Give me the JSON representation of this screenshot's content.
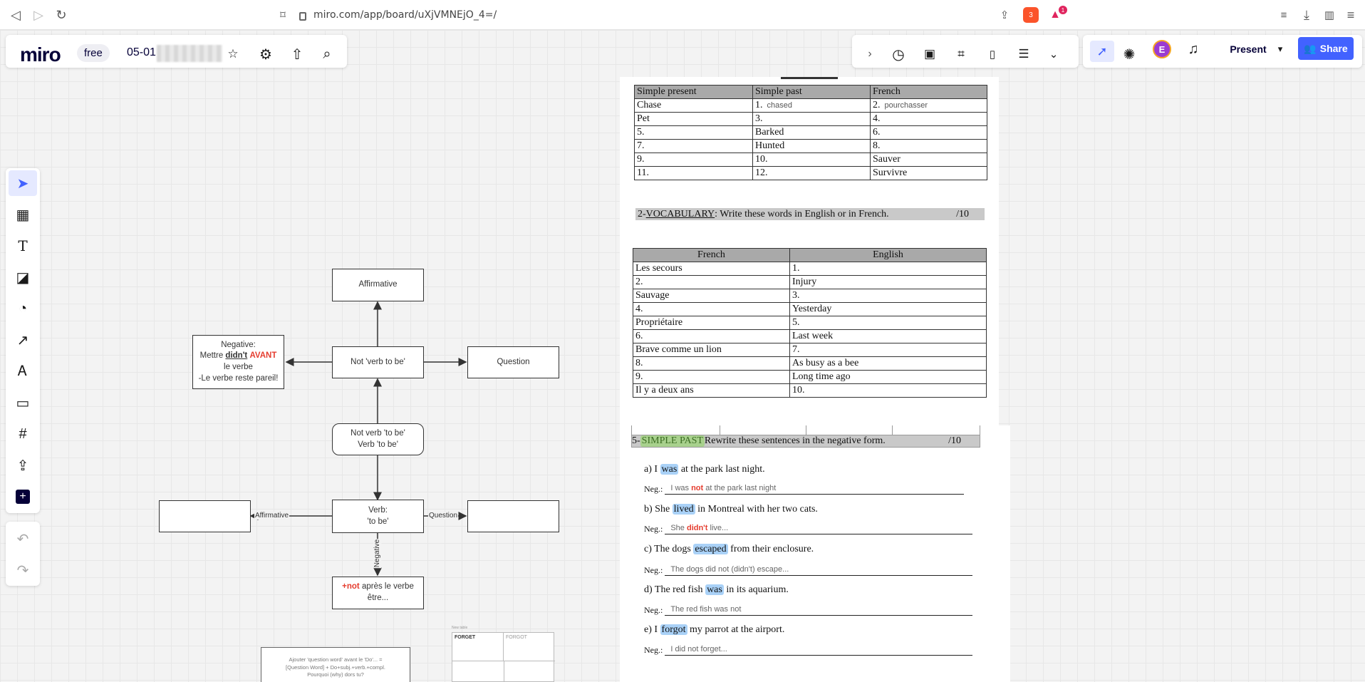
{
  "browser": {
    "url": "miro.com/app/board/uXjVMNEjO_4=/",
    "ext_badge_1": "3",
    "ext_badge_2": "1"
  },
  "header": {
    "logo": "miro",
    "plan_badge": "free",
    "board_name": "05-01"
  },
  "right_header": {
    "avatar_initial": "E",
    "present_label": "Present",
    "share_label": "Share"
  },
  "diagram": {
    "affirmative_top": "Affirmative",
    "not_verb_to_be": "Not 'verb to be'",
    "question_mid": "Question",
    "negative_line1": "Negative:",
    "negative_line2a": "Mettre ",
    "negative_line2b": "didn't",
    "negative_line2c": "AVANT",
    "negative_line3": "le verbe",
    "negative_line4": "-Le verbe reste pareil!",
    "choice_line1": "Not verb 'to be'",
    "choice_line2": "Verb 'to be'",
    "verb_line1": "Verb:",
    "verb_line2": "'to be'",
    "label_affirmative": "Affirmative",
    "label_question": "Question",
    "label_negative": "Negative",
    "not_box_a": "+not",
    "not_box_b": " après le verbe",
    "not_box_c": "être...",
    "small_note": "Ajouter 'question word' avant le 'Do'... = [Question Word] + Do+subj.+verb.+compl. Pourquoi (why) dors tu?",
    "mini_table_head1": "FORGET",
    "mini_table_head2": "FORGOT",
    "mini_caption": "New table"
  },
  "doc": {
    "table1": {
      "headers": [
        "Simple present",
        "Simple past",
        "French"
      ],
      "rows": [
        [
          "Chase",
          "1.",
          "2."
        ],
        [
          "Pet",
          "3.",
          "4."
        ],
        [
          "5.",
          "Barked",
          "6."
        ],
        [
          "7.",
          "Hunted",
          "8."
        ],
        [
          "9.",
          "10.",
          "Sauver"
        ],
        [
          "11.",
          "12.",
          "Survivre"
        ]
      ],
      "answer_chased": "chased",
      "answer_pourchasser": "pourchasser"
    },
    "vocab_title_num": "2- ",
    "vocab_title_word": "VOCABULARY",
    "vocab_title_rest": ": Write these words in English or in French.",
    "vocab_score": "/10",
    "table2": {
      "headers": [
        "French",
        "English"
      ],
      "rows": [
        [
          "Les secours",
          "1."
        ],
        [
          "2.",
          "Injury"
        ],
        [
          "Sauvage",
          "3."
        ],
        [
          "4.",
          "Yesterday"
        ],
        [
          "Propriétaire",
          "5."
        ],
        [
          "6.",
          "Last week"
        ],
        [
          "Brave comme un lion",
          "7."
        ],
        [
          "8.",
          "As busy as a bee"
        ],
        [
          "9.",
          "Long time ago"
        ],
        [
          "Il y a deux ans",
          "10."
        ]
      ]
    },
    "past_title_num": "5-",
    "past_title_word": "SIMPLE PAST",
    "past_title_rest": " Rewrite these sentences in the negative form.",
    "past_score": "/10",
    "neg_label": "Neg.:",
    "sentences": [
      {
        "pre": "a) I ",
        "hl": "was",
        "post": " at the park last night.",
        "ans_a": "I was ",
        "ans_red": "not",
        "ans_b": " at the park last night"
      },
      {
        "pre": "b) She ",
        "hl": "lived",
        "post": " in Montreal with her two cats.",
        "ans_a": "She ",
        "ans_red": "didn't",
        "ans_b": " live..."
      },
      {
        "pre": "c) The dogs ",
        "hl": "escaped",
        "post": " from their enclosure.",
        "ans_a": "The dogs did not (didn't) escape...",
        "ans_red": "",
        "ans_b": ""
      },
      {
        "pre": "d) The red fish ",
        "hl": "was",
        "post": " in its aquarium.",
        "ans_a": "The red fish was not",
        "ans_red": "",
        "ans_b": ""
      },
      {
        "pre": "e) I ",
        "hl": "forgot",
        "post": " my parrot at the airport.",
        "ans_a": "I did not forget...",
        "ans_red": "",
        "ans_b": ""
      }
    ]
  }
}
